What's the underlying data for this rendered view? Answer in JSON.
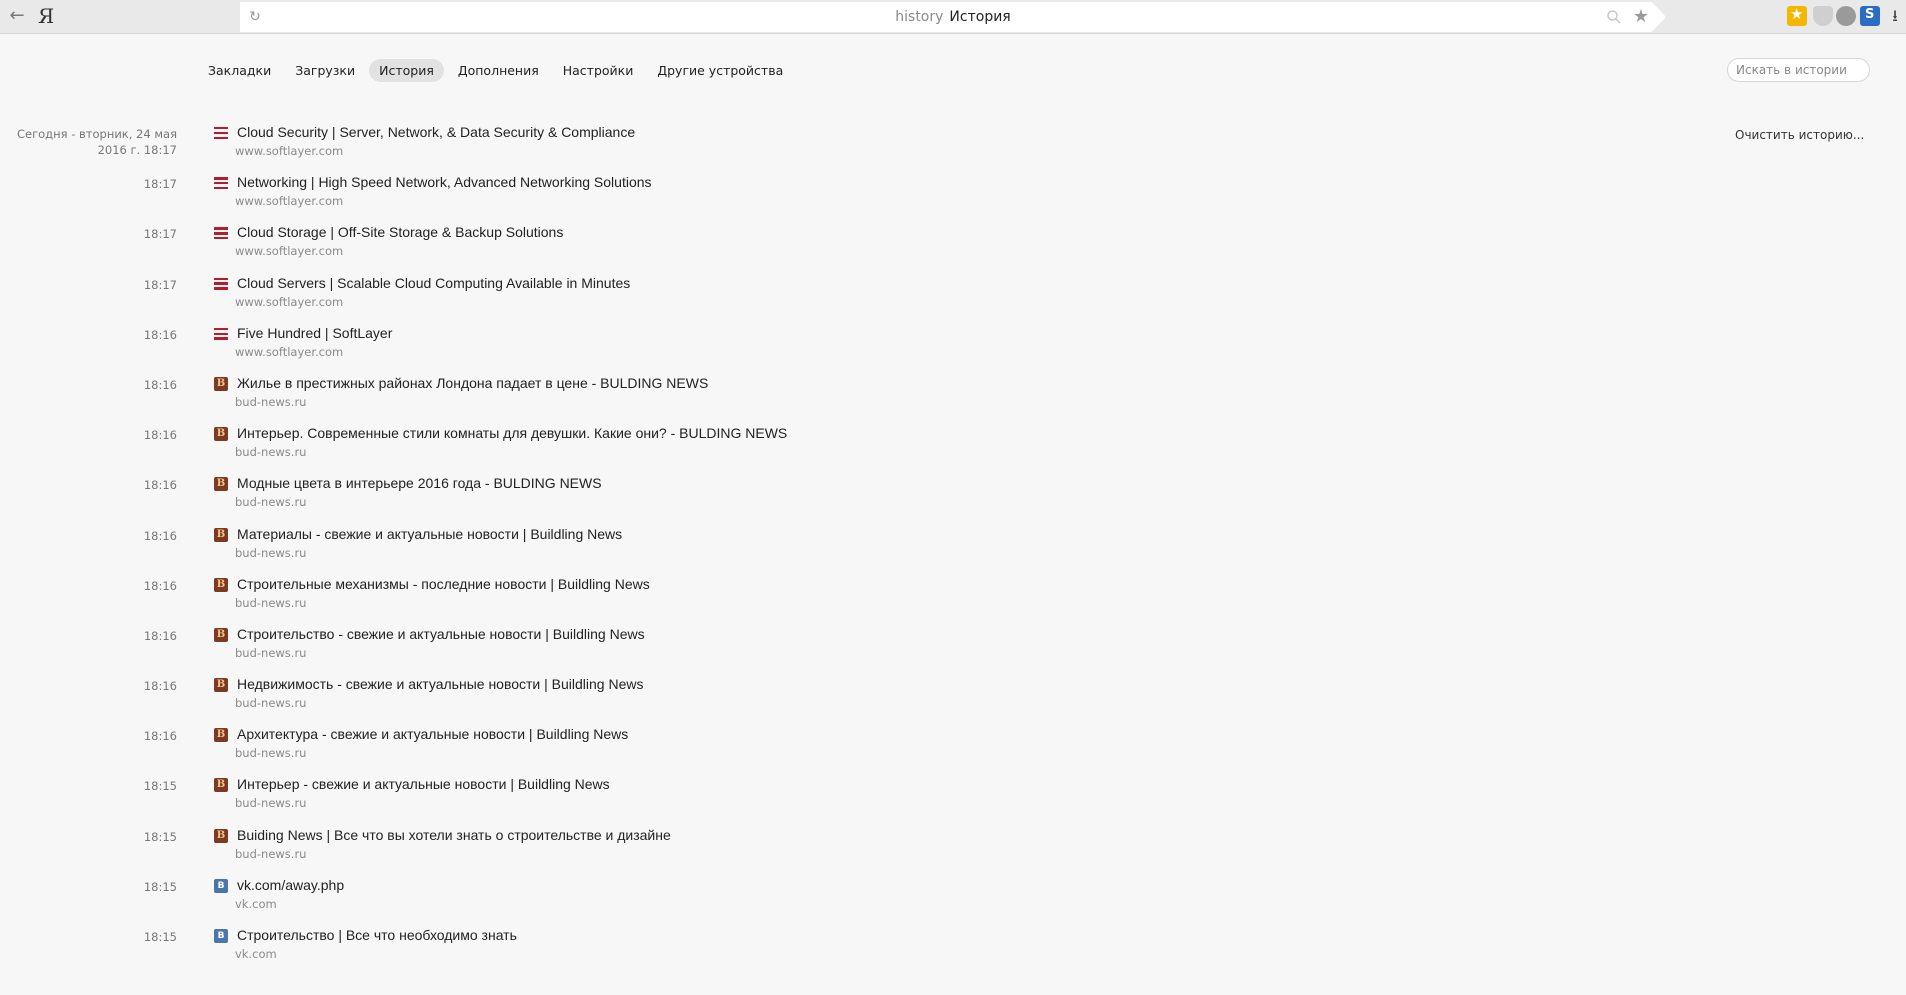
{
  "browser": {
    "logo": "Я",
    "address_host": "history",
    "address_title": "История",
    "back_glyph": "←",
    "reload_glyph": "↻",
    "star_glyph": "★",
    "download_glyph": "⭳",
    "icons": [
      "back-arrow-icon",
      "yandex-logo-icon",
      "reload-icon",
      "search-icon",
      "bookmark-star-icon",
      "extension-icon",
      "download-icon"
    ]
  },
  "nav": {
    "tabs": [
      {
        "label": "Закладки",
        "active": false
      },
      {
        "label": "Загрузки",
        "active": false
      },
      {
        "label": "История",
        "active": true
      },
      {
        "label": "Дополнения",
        "active": false
      },
      {
        "label": "Настройки",
        "active": false
      },
      {
        "label": "Другие устройства",
        "active": false
      }
    ]
  },
  "search": {
    "placeholder": "Искать в истории"
  },
  "clear_label": "Очистить историю...",
  "today_header": "Сегодня - вторник, 24 мая 2016 г.",
  "history": [
    {
      "time": "18:17",
      "favicon": "softlayer",
      "title": "Cloud Security | Server, Network, & Data Security & Compliance",
      "domain": "www.softlayer.com"
    },
    {
      "time": "18:17",
      "favicon": "softlayer",
      "title": "Networking | High Speed Network, Advanced Networking Solutions",
      "domain": "www.softlayer.com"
    },
    {
      "time": "18:17",
      "favicon": "softlayer",
      "title": "Cloud Storage | Off-Site Storage & Backup Solutions",
      "domain": "www.softlayer.com"
    },
    {
      "time": "18:17",
      "favicon": "softlayer",
      "title": "Cloud Servers | Scalable Cloud Computing Available in Minutes",
      "domain": "www.softlayer.com"
    },
    {
      "time": "18:16",
      "favicon": "softlayer",
      "title": "Five Hundred | SoftLayer",
      "domain": "www.softlayer.com"
    },
    {
      "time": "18:16",
      "favicon": "budnews",
      "title": "Жилье в престижных районах Лондона падает в цене - BULDING NEWS",
      "domain": "bud-news.ru"
    },
    {
      "time": "18:16",
      "favicon": "budnews",
      "title": "Интерьер. Современные стили комнаты для девушки. Какие они? - BULDING NEWS",
      "domain": "bud-news.ru"
    },
    {
      "time": "18:16",
      "favicon": "budnews",
      "title": "Модные цвета в интерьере 2016 года - BULDING NEWS",
      "domain": "bud-news.ru"
    },
    {
      "time": "18:16",
      "favicon": "budnews",
      "title": "Материалы - свежие и актуальные новости | Buildling News",
      "domain": "bud-news.ru"
    },
    {
      "time": "18:16",
      "favicon": "budnews",
      "title": "Строительные механизмы - последние новости | Buildling News",
      "domain": "bud-news.ru"
    },
    {
      "time": "18:16",
      "favicon": "budnews",
      "title": "Строительство - свежие и актуальные новости | Buildling News",
      "domain": "bud-news.ru"
    },
    {
      "time": "18:16",
      "favicon": "budnews",
      "title": "Недвижимость - свежие и актуальные новости | Buildling News",
      "domain": "bud-news.ru"
    },
    {
      "time": "18:16",
      "favicon": "budnews",
      "title": "Архитектура - свежие и актуальные новости | Buildling News",
      "domain": "bud-news.ru"
    },
    {
      "time": "18:15",
      "favicon": "budnews",
      "title": "Интерьер - свежие и актуальные новости | Buildling News",
      "domain": "bud-news.ru"
    },
    {
      "time": "18:15",
      "favicon": "budnews",
      "title": "Buiding News | Все что вы хотели знать о строительстве и дизайне",
      "domain": "bud-news.ru"
    },
    {
      "time": "18:15",
      "favicon": "vk",
      "title": "vk.com/away.php",
      "domain": "vk.com"
    },
    {
      "time": "18:15",
      "favicon": "vk",
      "title": "Строительство | Все что необходимо знать",
      "domain": "vk.com"
    }
  ],
  "colors": {
    "background": "#f7f7f7",
    "softlayer_red": "#b11e2e",
    "budnews_brown": "#7b3a22",
    "vk_blue": "#4a76a8"
  }
}
